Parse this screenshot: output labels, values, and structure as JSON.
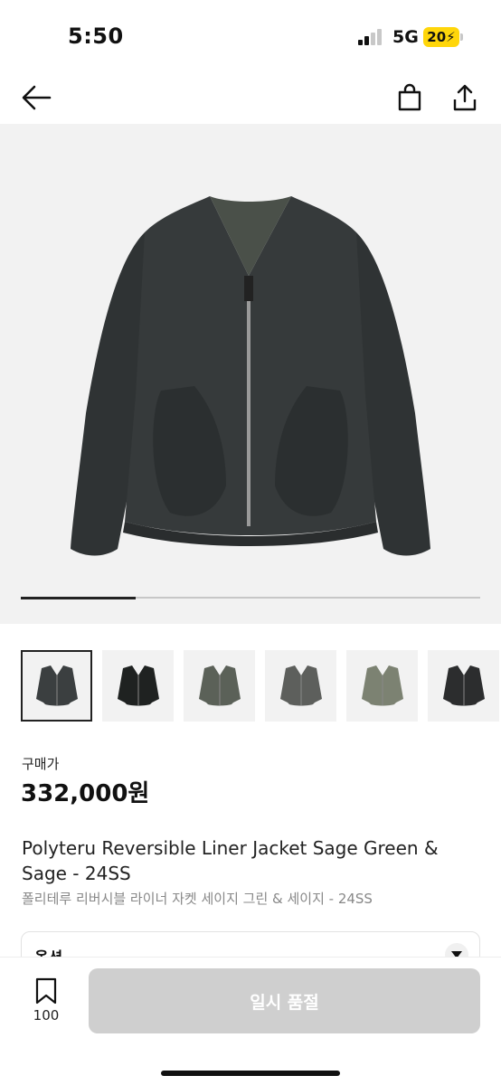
{
  "status": {
    "time": "5:50",
    "network": "5G",
    "battery": "20"
  },
  "hero": {
    "image_alt": "jacket-photo",
    "progress": 0.25
  },
  "thumbnails": [
    {
      "color": "#3b3f40"
    },
    {
      "color": "#1f2221"
    },
    {
      "color": "#5b6158"
    },
    {
      "color": "#5d5f5c"
    },
    {
      "color": "#7c8272"
    },
    {
      "color": "#2c2d2e"
    }
  ],
  "product": {
    "price_label": "구매가",
    "price": "332,000원",
    "title_en": "Polyteru Reversible Liner Jacket Sage Green & Sage - 24SS",
    "title_ko": "폴리테루 리버시블 라이너 자켓 세이지 그린 & 세이지 - 24SS"
  },
  "option": {
    "label": "옵션"
  },
  "bottom": {
    "bookmark_count": "100",
    "cta_label": "일시 품절"
  }
}
